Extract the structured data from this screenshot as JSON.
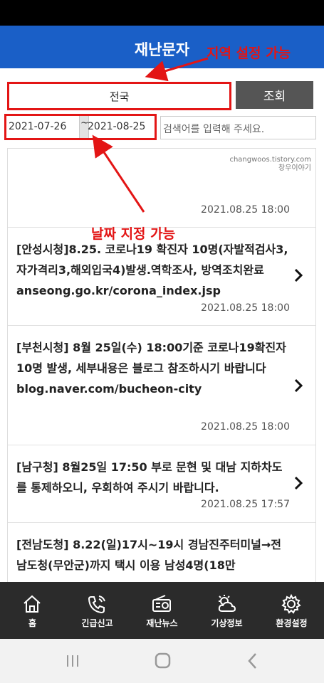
{
  "header": {
    "title": "재난문자"
  },
  "filters": {
    "region": "전국",
    "search_label": "조회",
    "date_start": "2021-07-26",
    "date_separator": "~",
    "date_end": "2021-08-25",
    "keyword_placeholder": "검색어를 입력해 주세요."
  },
  "watermark": {
    "line1": "changwoos.tistory.com",
    "line2": "창우이야기"
  },
  "annotations": {
    "region_note": "지역 설정 가능",
    "date_note": "날짜 지정 가능",
    "color": "#e31515"
  },
  "messages": [
    {
      "text": "",
      "time": "2021.08.25 18:00"
    },
    {
      "text": "[안성시청]8.25. 코로나19 확진자 10명(자발적검사3,자가격리3,해외입국4)발생.역학조사, 방역조치완료anseong.go.kr/corona_index.jsp",
      "time": "2021.08.25 18:00"
    },
    {
      "text": "[부천시청] 8월 25일(수) 18:00기준 코로나19확진자 10명 발생, 세부내용은 블로그 참조하시기 바랍니다 blog.naver.com/bucheon-city",
      "time": "2021.08.25 18:00"
    },
    {
      "text": "[남구청] 8월25일 17:50 부로 문현 및 대남 지하차도를 통제하오니, 우회하여 주시기 바랍니다.",
      "time": "2021.08.25 17:57"
    },
    {
      "text": "[전남도청] 8.22(일)17시~19시 경남진주터미널→전남도청(무안군)까지 택시 이용 남성4명(18만",
      "time": ""
    }
  ],
  "bottom_nav": [
    {
      "label": "홈",
      "icon": "home-icon"
    },
    {
      "label": "긴급신고",
      "icon": "phone-icon"
    },
    {
      "label": "재난뉴스",
      "icon": "radio-icon"
    },
    {
      "label": "기상정보",
      "icon": "weather-icon"
    },
    {
      "label": "환경설정",
      "icon": "gear-icon"
    }
  ],
  "colors": {
    "header": "#1a5fc7",
    "search_button": "#555555",
    "nav": "#2b2b2b"
  }
}
